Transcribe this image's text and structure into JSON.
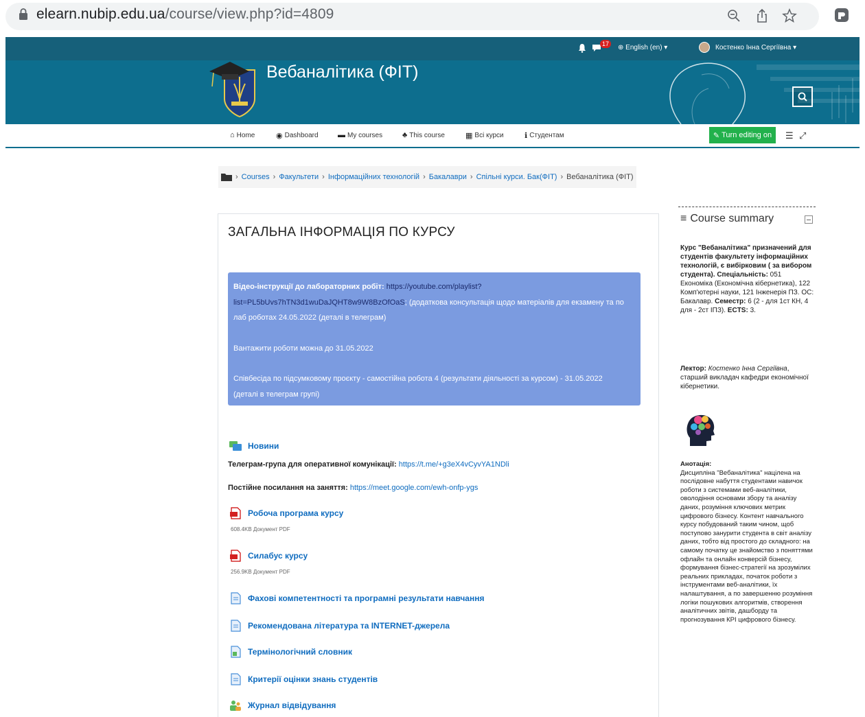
{
  "browser": {
    "url_host": "elearn.nubip.edu.ua",
    "url_path": "/course/view.php?id=4809"
  },
  "header": {
    "notifications_count": "17",
    "language": "English (en)",
    "user_name": "Костенко Інна Сергіївна",
    "course_title": "Вебаналітика (ФІТ)"
  },
  "menu": {
    "items": [
      {
        "label": "Home",
        "icon": "home-icon"
      },
      {
        "label": "Dashboard",
        "icon": "dashboard-icon"
      },
      {
        "label": "My courses",
        "icon": "courses-icon"
      },
      {
        "label": "This course",
        "icon": "sitemap-icon"
      },
      {
        "label": "Всі курси",
        "icon": "grid-icon"
      },
      {
        "label": "Студентам",
        "icon": "info-icon"
      }
    ],
    "edit_button": "Turn editing on"
  },
  "breadcrumb": {
    "items": [
      "Courses",
      "Факультети",
      "Інформаційних технологій",
      "Бакалаври",
      "Спільні курси. Бак(ФІТ)"
    ],
    "current": "Вебаналітика (ФІТ)"
  },
  "section": {
    "title": "ЗАГАЛЬНА ІНФОРМАЦІЯ ПО КУРСУ"
  },
  "notice": {
    "video_label": "Відео-інструкції до лабораторних робіт:",
    "video_link_1": "https://youtube.com/playlist?",
    "video_link_2": "list=PL5bUvs7hTN3d1wuDaJQHT8w9W8BzOfOaS",
    "video_after": "; (додаткова консультація щодо матеріалів для екзамену та по",
    "video_after_2": "лаб роботах 24.05.2022 (деталі в телеграм)",
    "upload_deadline": "Вантажити роботи можна до 31.05.2022",
    "interview_1": "Співбесіда по підсумковому проєкту  - самостійна робота 4 (результати діяльності за курсом) - 31.05.2022",
    "interview_2": "(деталі в телеграм групі)"
  },
  "activities": {
    "news": "Новини",
    "telegram_label": "Телеграм-група для оперативної комунікації:",
    "telegram_link": "https://t.me/+g3eX4vCyvYA1NDli",
    "meet_label": "Постійне посилання на заняття:",
    "meet_link": "https://meet.google.com/ewh-onfp-ygs",
    "program": "Робоча програма курсу",
    "program_meta": "608.4KB Документ PDF",
    "syllabus": "Силабус курсу",
    "syllabus_meta": "256.9KB Документ PDF",
    "competences": "Фахові компетентності та програмні результати навчання",
    "literature": "Рекомендована література та INTERNET-джерела",
    "glossary": "Термінологічний словник",
    "criteria": "Критерії оцінки знань студентів",
    "attendance": "Журнал відвідування"
  },
  "sidebar": {
    "title": "Course summary",
    "intro_bold": "Курс \"Вебаналітика\" призначений для студентів факультету інформаційних технологій, є вибірковим ( за вибором студента).",
    "speciality_label": "Спеціальність:",
    "speciality": " 051 Економіка (Економічна кібернетика), 122 Комп'ютерні науки, 121 Інженерія ПЗ. ОС: Бакалавр. ",
    "semester_label": "Семестр:",
    "semester": " 6 (2 - для 1ст КН, 4 для - 2ст ІПЗ). ",
    "ects_label": "ECTS:",
    "ects": " 3.",
    "lector_label": "Лектор:",
    "lector_name": " Костенко Інна Сергіївна",
    "lector_rest": ", старший викладач кафедри економічної кібернетики.",
    "annotation_label": "Анотація:",
    "annotation": "Дисципліна \"Вебаналітика\" націлена на послідовне набуття студентами навичок роботи з системами веб-аналітики, оволодіння основами збору та аналізу даних, розуміння ключових метрик цифрового бізнесу. Контент навчального курсу побудований таким чином, щоб поступово занурити студента в світ аналізу даних, тобто від простого до складного: на самому початку це знайомство з поняттями офлайн та онлайн конверсій бізнесу, формування бізнес-стратегії на зрозумілих реальних прикладах, початок роботи з інструментами веб-аналітики, їх налаштування, а по завершенню розуміння логіки пошукових алгоритмів, створення аналітичних звітів, дашборду та прогнозування КРІ цифрового бізнесу."
  },
  "colors": {
    "header_dark": "#16607a",
    "header": "#0d6e8e",
    "notice_bg": "#7b9be0",
    "link": "#0f6cbf",
    "edit_green": "#22b14c"
  }
}
